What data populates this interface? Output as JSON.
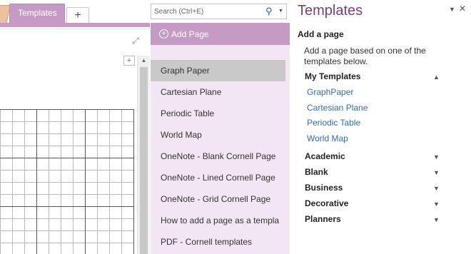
{
  "section_tabs": {
    "active_label": "Templates",
    "add_symbol": "+"
  },
  "search": {
    "placeholder": "Search (Ctrl+E)",
    "icon": "search-icon"
  },
  "pages_pane": {
    "add_page_label": "Add Page",
    "pages": [
      {
        "label": "Graph Paper",
        "selected": true
      },
      {
        "label": "Cartesian Plane",
        "selected": false
      },
      {
        "label": "Periodic Table",
        "selected": false
      },
      {
        "label": "World Map",
        "selected": false
      },
      {
        "label": "OneNote - Blank Cornell Page",
        "selected": false
      },
      {
        "label": "OneNote - Lined Cornell Page",
        "selected": false
      },
      {
        "label": "OneNote - Grid Cornell Page",
        "selected": false
      },
      {
        "label": "How to add a page as a templa",
        "selected": false
      },
      {
        "label": "PDF - Cornell templates",
        "selected": false
      }
    ]
  },
  "templates_pane": {
    "title": "Templates",
    "add_heading": "Add a page",
    "description": "Add a page based on one of the templates below.",
    "my_templates": {
      "label": "My Templates",
      "items": [
        "GraphPaper",
        "Cartesian Plane",
        "Periodic Table",
        "World Map"
      ]
    },
    "categories": [
      "Academic",
      "Blank",
      "Business",
      "Decorative",
      "Planners"
    ]
  },
  "colors": {
    "section_accent": "#c59bc6",
    "page_list_bg": "#f3e6f3",
    "title_purple": "#7b3f7d",
    "link_blue": "#2e6fb7"
  }
}
